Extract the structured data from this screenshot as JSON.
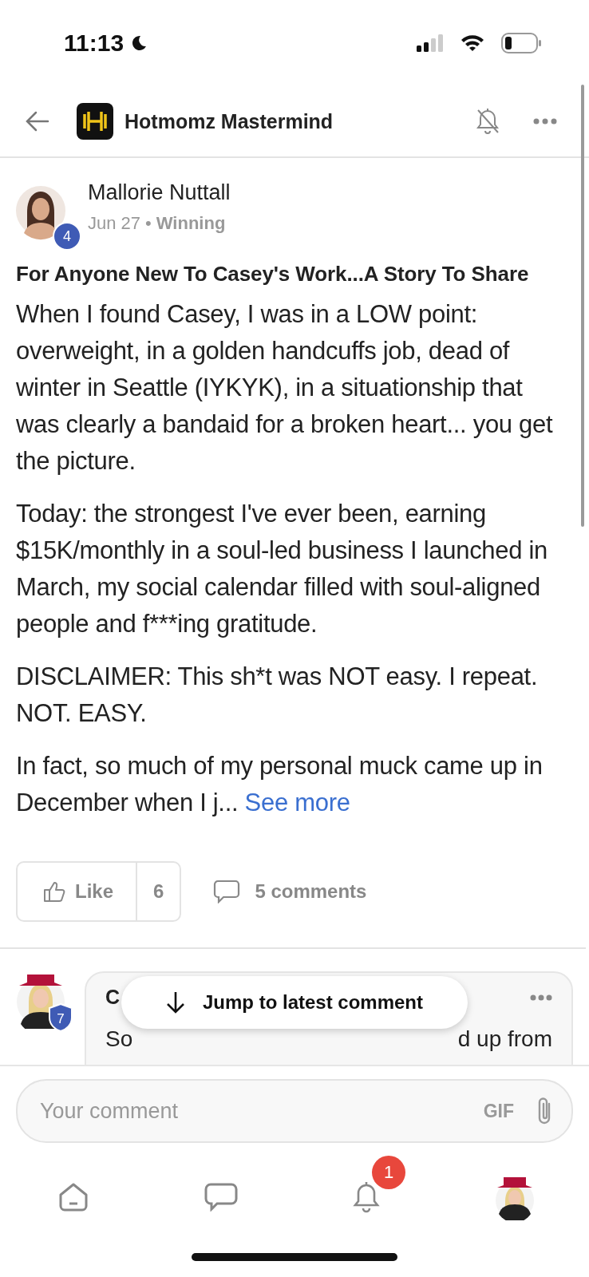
{
  "status_bar": {
    "time": "11:13"
  },
  "header": {
    "title": "Hotmomz Mastermind"
  },
  "post": {
    "author": "Mallorie Nuttall",
    "author_level": "4",
    "date": "Jun 27",
    "separator": "•",
    "category": "Winning",
    "title": "For Anyone New To Casey's Work...A Story To Share",
    "paragraphs": [
      "When I found Casey, I was in a LOW point: overweight, in a golden handcuffs job, dead of winter in Seattle (IYKYK), in a situationship that was clearly a bandaid for a broken heart... you get the picture.",
      "Today: the strongest I've ever been, earning $15K/monthly in a soul-led business I launched in March, my social calendar filled with soul-aligned people and f***ing gratitude.",
      "DISCLAIMER: This sh*t was NOT easy. I repeat. NOT. EASY.",
      "In fact, so much of my personal muck came up in December when I j..."
    ],
    "see_more": "See more",
    "like_label": "Like",
    "like_count": "6",
    "comments_label": "5 comments"
  },
  "comment": {
    "author": "C",
    "author_level": "7",
    "text_start": "So",
    "text_end": "d up from"
  },
  "jump_button": {
    "label": "Jump to latest comment"
  },
  "composer": {
    "placeholder": "Your comment",
    "gif_label": "GIF"
  },
  "tab_bar": {
    "notification_count": "1"
  }
}
